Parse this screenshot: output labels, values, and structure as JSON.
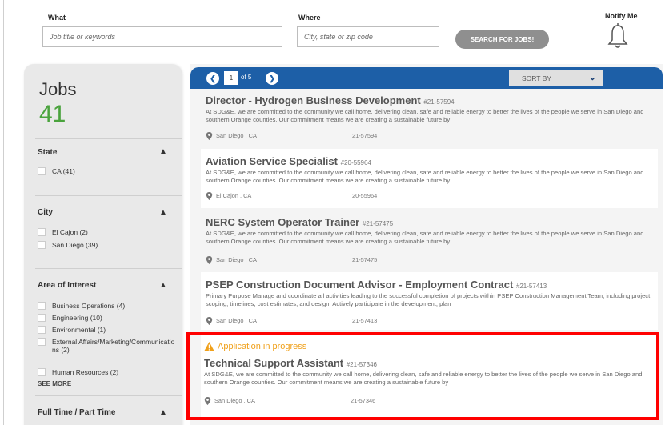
{
  "search": {
    "what_label": "What",
    "what_placeholder": "Job title or keywords",
    "where_label": "Where",
    "where_placeholder": "City, state or zip code",
    "search_button": "SEARCH FOR JOBS!",
    "notify_label": "Notify Me"
  },
  "sidebar": {
    "title": "Jobs",
    "count": "41",
    "facets": {
      "state": {
        "title": "State",
        "options": [
          "CA (41)"
        ]
      },
      "city": {
        "title": "City",
        "options": [
          "El Cajon (2)",
          "San Diego (39)"
        ]
      },
      "area": {
        "title": "Area of Interest",
        "options": [
          "Business Operations (4)",
          "Engineering (10)",
          "Environmental (1)",
          "External Affairs/Marketing/Communications (2)",
          "Human Resources (2)"
        ],
        "see_more": "SEE MORE"
      },
      "fulltime": {
        "title": "Full Time / Part Time"
      }
    }
  },
  "pager": {
    "current_page": "1",
    "of_text": "of 5",
    "sort_label": "SORT BY"
  },
  "jobs": [
    {
      "title": "Director - Hydrogen Business Development",
      "id": "#21-57594",
      "desc": "At SDG&E, we are committed to the community we call home, delivering clean, safe and reliable energy to better the lives of the people we serve in San Diego and southern Orange counties. Our commitment means we are creating a sustainable future by",
      "location": "San Diego , CA",
      "req": "21-57594"
    },
    {
      "title": "Aviation Service Specialist",
      "id": "#20-55964",
      "desc": "At SDG&E, we are committed to the community we call home, delivering clean, safe and reliable energy to better the lives of the people we serve in San Diego and southern Orange counties. Our commitment means we are creating a sustainable future by",
      "location": "El Cajon , CA",
      "req": "20-55964"
    },
    {
      "title": "NERC System Operator Trainer",
      "id": "#21-57475",
      "desc": "At SDG&E, we are committed to the community we call home, delivering clean, safe and reliable energy to better the lives of the people we serve in San Diego and southern Orange counties. Our commitment means we are creating a sustainable future by",
      "location": "San Diego , CA",
      "req": "21-57475"
    },
    {
      "title": "PSEP Construction Document Advisor - Employment Contract",
      "id": "#21-57413",
      "desc": "Primary Purpose Manage and coordinate all activities leading to the successful completion of projects within PSEP Construction Management Team, including project scoping, timelines, cost estimates, and design. Actively participate in the development, plan",
      "location": "San Diego , CA",
      "req": "21-57413"
    },
    {
      "status": "Application in progress",
      "title": "Technical Support Assistant",
      "id": "#21-57346",
      "desc": "At SDG&E, we are committed to the community we call home, delivering clean, safe and reliable energy to better the lives of the people we serve in San Diego and southern Orange counties. Our commitment means we are creating a sustainable future by",
      "location": "San Diego , CA",
      "req": "21-57346"
    }
  ],
  "colors": {
    "accent": "#1d5fa7",
    "count_green": "#4aa33d",
    "warning": "#f0a01a",
    "highlight": "#ff0000"
  }
}
